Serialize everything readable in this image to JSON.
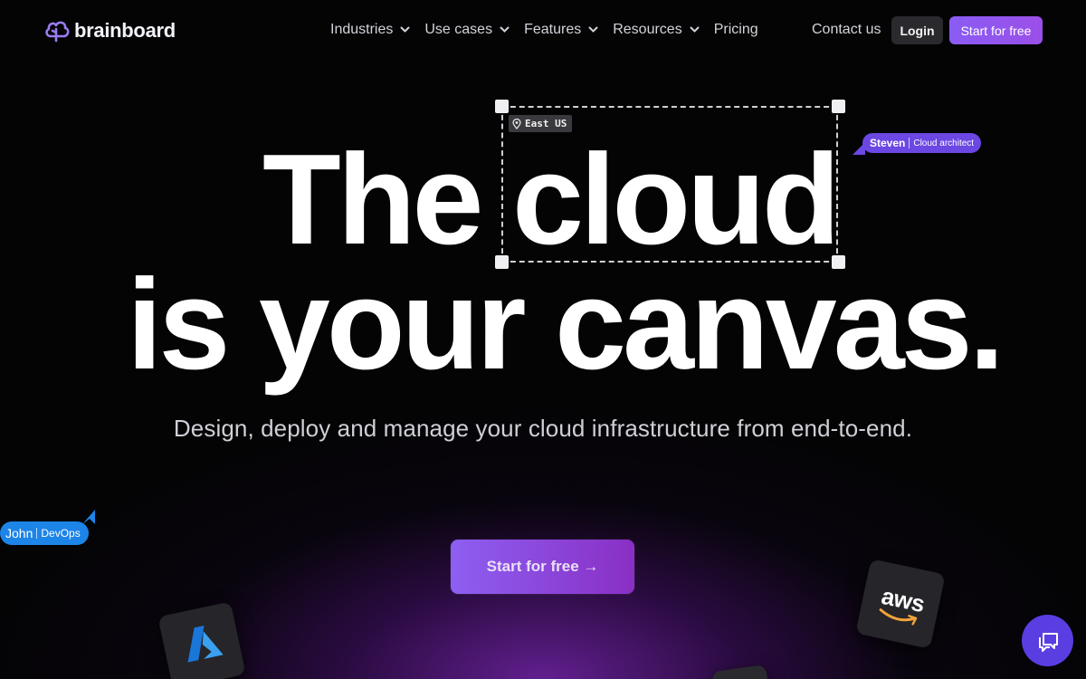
{
  "nav": {
    "logo_text": "brainboard",
    "menu": [
      {
        "label": "Industries",
        "has_dropdown": true
      },
      {
        "label": "Use cases",
        "has_dropdown": true
      },
      {
        "label": "Features",
        "has_dropdown": true
      },
      {
        "label": "Resources",
        "has_dropdown": true
      },
      {
        "label": "Pricing",
        "has_dropdown": false
      }
    ],
    "contact_label": "Contact us",
    "login_label": "Login",
    "start_label": "Start for free"
  },
  "hero": {
    "line1_word1": "The",
    "line1_word2": "cloud",
    "line2": "is your canvas.",
    "region_tag": "East US",
    "subtitle": "Design, deploy and manage your cloud infrastructure from end-to-end.",
    "cta_label": "Start for free →"
  },
  "cursors": {
    "steven": {
      "name": "Steven",
      "role": "Cloud architect",
      "color": "#6b47e3"
    },
    "john": {
      "name": "John",
      "role": "DevOps",
      "color": "#1d84e8"
    }
  },
  "tiles": {
    "aws_text": "aws"
  },
  "colors": {
    "accent": "#8a5cf4",
    "background": "#040405",
    "chat": "#5a3ee2"
  }
}
